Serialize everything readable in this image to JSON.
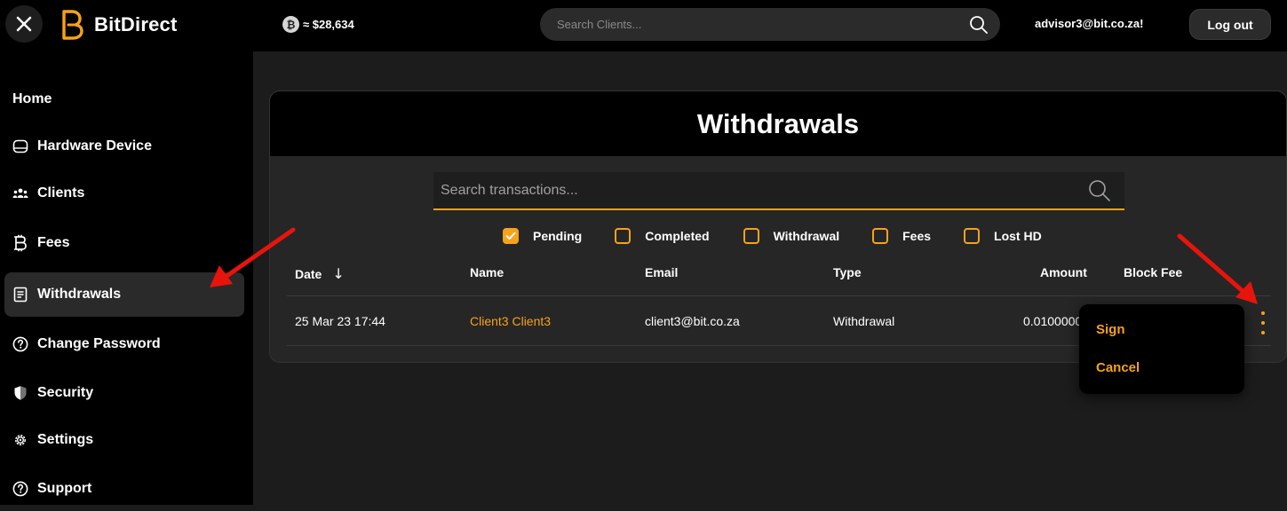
{
  "app": {
    "brand": "BitDirect",
    "btc_symbol": "₿",
    "btc_price": "≈ $28,634",
    "search_placeholder": "Search Clients...",
    "user_email": "advisor3@bit.co.za!",
    "logout_label": "Log out",
    "accent_color": "#f7a21b"
  },
  "sidebar": {
    "items": [
      {
        "label": "Home",
        "icon": "none",
        "active": false
      },
      {
        "label": "Hardware Device",
        "icon": "hardware-device-icon",
        "active": false
      },
      {
        "label": "Clients",
        "icon": "clients-icon",
        "active": false
      },
      {
        "label": "Fees",
        "icon": "bitcoin-icon",
        "active": false
      },
      {
        "label": "Withdrawals",
        "icon": "withdrawals-icon",
        "active": true
      },
      {
        "label": "Change Password",
        "icon": "question-icon",
        "active": false
      },
      {
        "label": "Security",
        "icon": "shield-icon",
        "active": false
      },
      {
        "label": "Settings",
        "icon": "gear-icon",
        "active": false
      },
      {
        "label": "Support",
        "icon": "support-icon",
        "active": false
      }
    ]
  },
  "withdrawals": {
    "title": "Withdrawals",
    "search_placeholder": "Search transactions...",
    "filters": [
      {
        "label": "Pending",
        "checked": true
      },
      {
        "label": "Completed",
        "checked": false
      },
      {
        "label": "Withdrawal",
        "checked": false
      },
      {
        "label": "Fees",
        "checked": false
      },
      {
        "label": "Lost HD",
        "checked": false
      }
    ],
    "columns": {
      "date": "Date",
      "sort_symbol": "↓",
      "name": "Name",
      "email": "Email",
      "type": "Type",
      "amount": "Amount",
      "block_fee": "Block Fee"
    },
    "rows": [
      {
        "date": "25 Mar 23 17:44",
        "name": "Client3 Client3",
        "email": "client3@bit.co.za",
        "type": "Withdrawal",
        "amount": "0.0100000"
      }
    ],
    "row_menu": {
      "sign_label": "Sign",
      "cancel_label": "Cancel"
    }
  }
}
